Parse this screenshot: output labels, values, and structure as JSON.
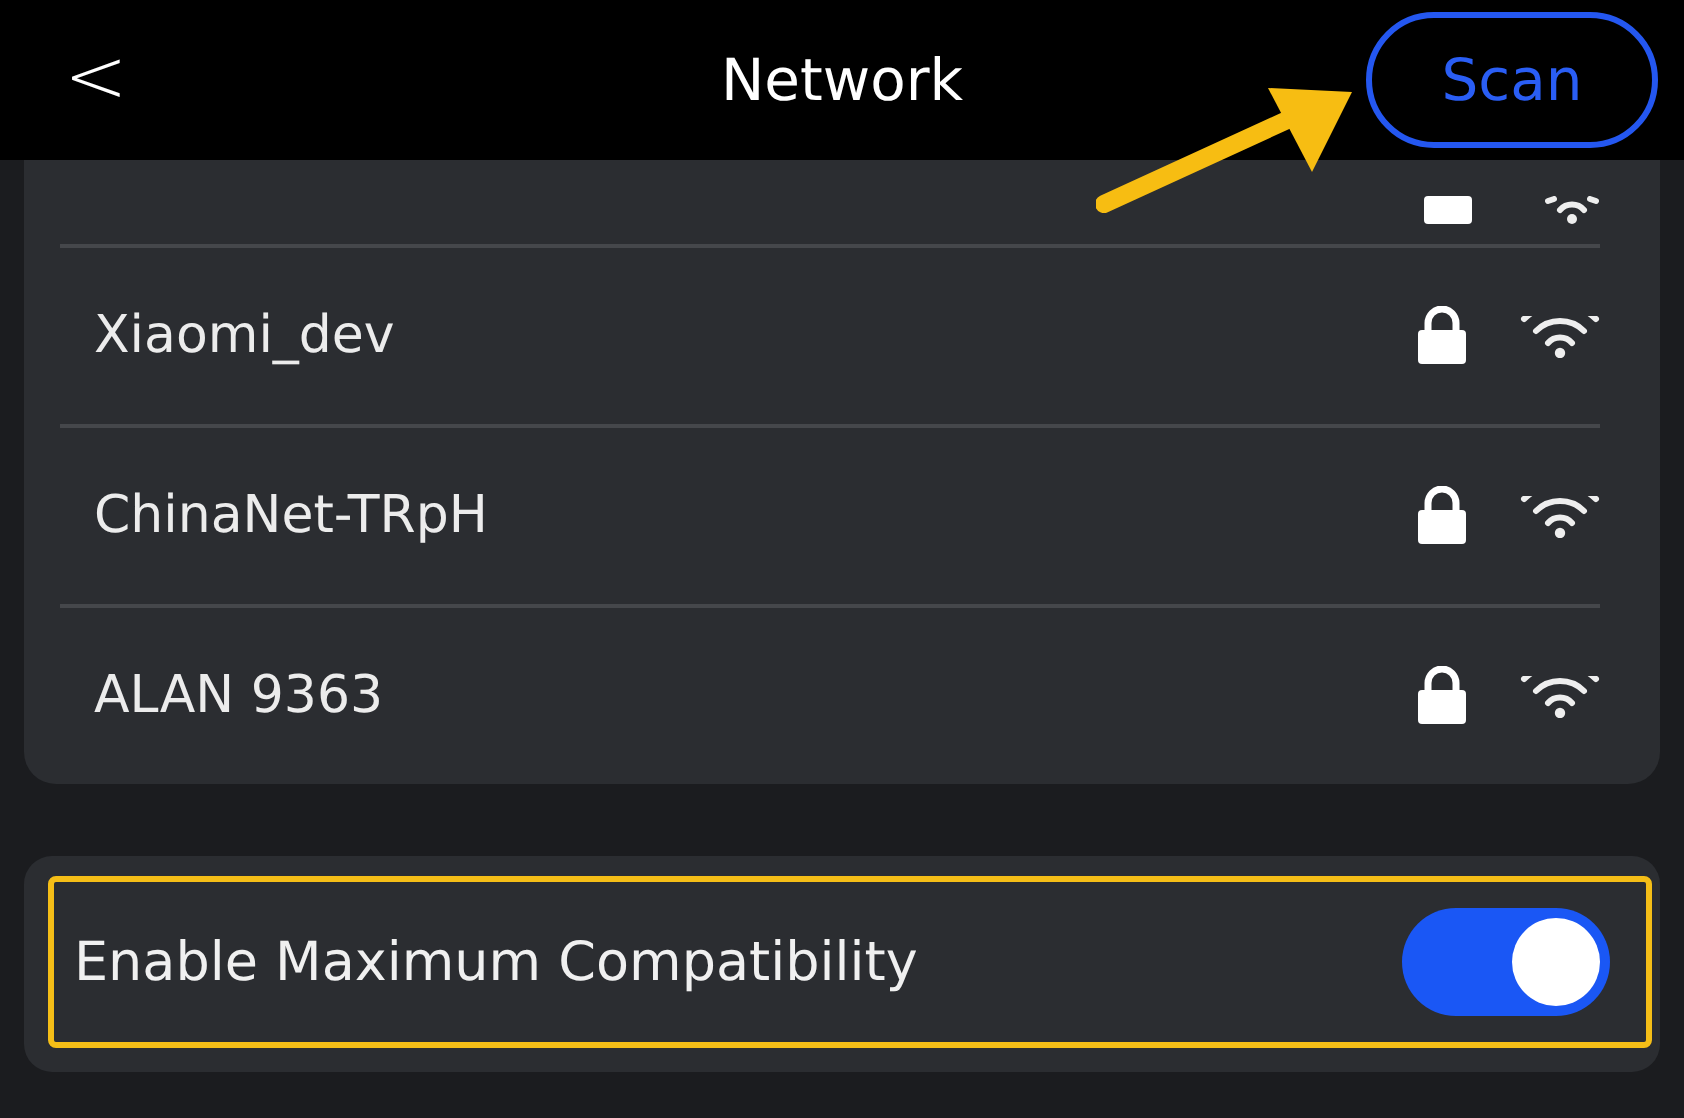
{
  "header": {
    "back": "<",
    "title": "Network",
    "scan_button": "Scan"
  },
  "networks": [
    {
      "name": "Xiaomi_dev"
    },
    {
      "name": "ChinaNet-TRpH"
    },
    {
      "name": "ALAN 9363"
    }
  ],
  "settings": [
    {
      "label": "Enable Maximum Compatibility",
      "on": true,
      "highlighted": true
    }
  ]
}
